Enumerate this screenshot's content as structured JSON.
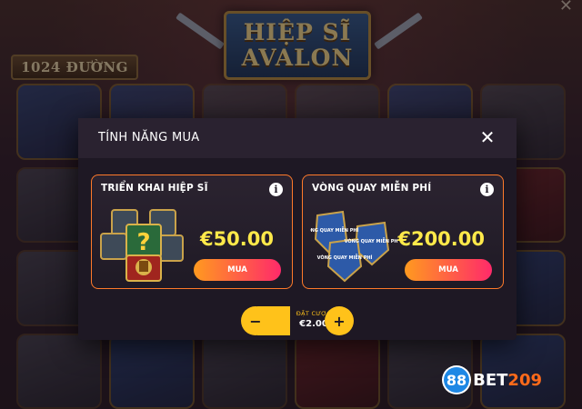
{
  "game": {
    "title_line1": "HIỆP SĨ",
    "title_line2": "AVALON",
    "ways": "1024 ĐƯỜNG"
  },
  "modal": {
    "title": "TÍNH NĂNG MUA",
    "close_icon": "close-icon",
    "features": [
      {
        "title": "TRIỂN KHAI HIỆP SĨ",
        "price": "€50.00",
        "buy_label": "MUA",
        "icon": "knight-mystery-symbols"
      },
      {
        "title": "VÒNG QUAY MIỄN PHÍ",
        "price": "€200.00",
        "buy_label": "MUA",
        "icon": "free-spins-shields"
      }
    ],
    "bet": {
      "label": "ĐẶT CƯỢC",
      "value": "€2.00",
      "minus": "−",
      "plus": "+"
    }
  },
  "shield_labels": [
    "VÒNG QUAY MIỄN PHÍ",
    "VÒNG QUAY MIỄN PHÍ",
    "VÒNG QUAY MIỄN PHÍ"
  ],
  "watermark": {
    "badge": "88",
    "text_a": "BET",
    "text_b": "209"
  },
  "colors": {
    "accent_orange": "#ff7a2a",
    "price_yellow": "#ffe94a",
    "bet_yellow": "#ffc21a",
    "button_gradient_start": "#ff9a1f",
    "button_gradient_end": "#ff2a6a",
    "modal_bg": "#1e1824"
  }
}
